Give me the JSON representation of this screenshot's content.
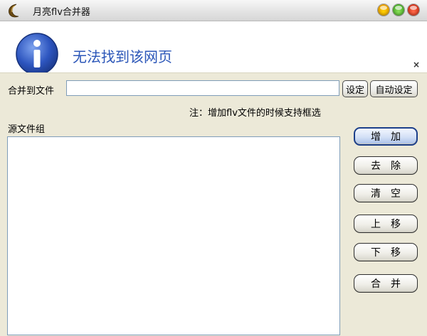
{
  "window": {
    "title": "月亮flv合并器"
  },
  "error": {
    "message": "无法找到该网页",
    "dismiss": "×"
  },
  "form": {
    "merge_to_file_label": "合并到文件",
    "merge_to_file_value": "",
    "set_button": "设定",
    "auto_set_button": "自动设定",
    "note": "注：增加flv文件的时候支持框选",
    "source_group_label": "源文件组",
    "source_files": []
  },
  "actions": {
    "add": "增加",
    "remove": "去除",
    "clear": "清空",
    "move_up": "上移",
    "move_down": "下移",
    "merge": "合并"
  },
  "colors": {
    "panel_bg": "#ece9d8",
    "error_text": "#2b56b8",
    "info_icon": "#2b4fb3"
  },
  "icons": {
    "app": "moon-icon",
    "info": "info-icon",
    "minimize": "minimize-icon",
    "maximize": "maximize-icon",
    "close": "close-icon"
  }
}
